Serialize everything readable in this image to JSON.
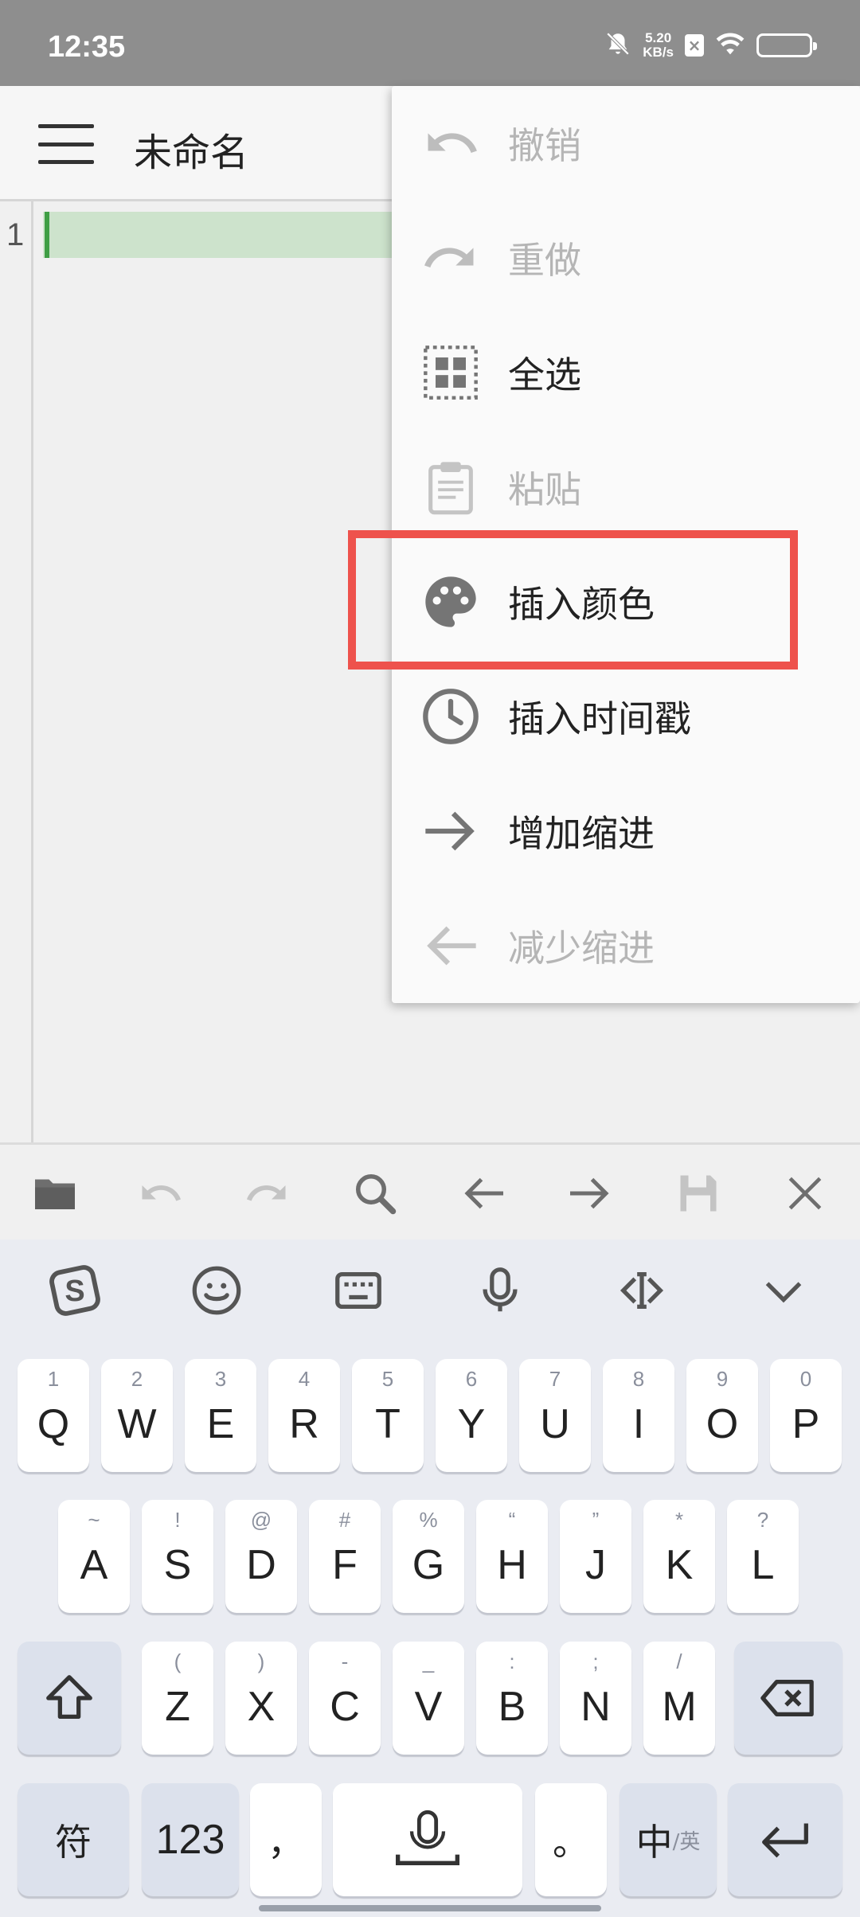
{
  "status_bar": {
    "time": "12:35",
    "net_speed_value": "5.20",
    "net_speed_unit": "KB/s",
    "icons": [
      "mute-bell-icon",
      "close-badge-icon",
      "wifi-icon",
      "battery-icon"
    ]
  },
  "toolbar": {
    "title": "未命名"
  },
  "editor": {
    "line_number": "1"
  },
  "dropdown": {
    "items": [
      {
        "label": "撤销",
        "icon": "undo-icon",
        "enabled": false
      },
      {
        "label": "重做",
        "icon": "redo-icon",
        "enabled": false
      },
      {
        "label": "全选",
        "icon": "select-all-icon",
        "enabled": true
      },
      {
        "label": "粘贴",
        "icon": "paste-icon",
        "enabled": false
      },
      {
        "label": "插入颜色",
        "icon": "palette-icon",
        "enabled": true,
        "highlighted": true
      },
      {
        "label": "插入时间戳",
        "icon": "clock-icon",
        "enabled": true
      },
      {
        "label": "增加缩进",
        "icon": "arrow-right-icon",
        "enabled": true
      },
      {
        "label": "减少缩进",
        "icon": "arrow-left-icon",
        "enabled": false
      }
    ],
    "highlight_color": "#ee524c"
  },
  "action_bar": {
    "icons": [
      "folder-icon",
      "undo-icon",
      "redo-icon",
      "search-icon",
      "arrow-left-icon",
      "arrow-right-icon",
      "save-icon",
      "close-icon"
    ]
  },
  "keyboard": {
    "toolbar_icons": [
      "sogou-logo-icon",
      "emoji-icon",
      "keyboard-icon",
      "microphone-icon",
      "cursor-icon",
      "chevron-down-icon"
    ],
    "row1": [
      {
        "main": "Q",
        "sub": "1"
      },
      {
        "main": "W",
        "sub": "2"
      },
      {
        "main": "E",
        "sub": "3"
      },
      {
        "main": "R",
        "sub": "4"
      },
      {
        "main": "T",
        "sub": "5"
      },
      {
        "main": "Y",
        "sub": "6"
      },
      {
        "main": "U",
        "sub": "7"
      },
      {
        "main": "I",
        "sub": "8"
      },
      {
        "main": "O",
        "sub": "9"
      },
      {
        "main": "P",
        "sub": "0"
      }
    ],
    "row2": [
      {
        "main": "A",
        "sub": "~"
      },
      {
        "main": "S",
        "sub": "!"
      },
      {
        "main": "D",
        "sub": "@"
      },
      {
        "main": "F",
        "sub": "#"
      },
      {
        "main": "G",
        "sub": "%"
      },
      {
        "main": "H",
        "sub": "“"
      },
      {
        "main": "J",
        "sub": "”"
      },
      {
        "main": "K",
        "sub": "*"
      },
      {
        "main": "L",
        "sub": "?"
      }
    ],
    "row3": [
      {
        "main": "Z",
        "sub": "("
      },
      {
        "main": "X",
        "sub": ")"
      },
      {
        "main": "C",
        "sub": "-"
      },
      {
        "main": "V",
        "sub": "_"
      },
      {
        "main": "B",
        "sub": ":"
      },
      {
        "main": "N",
        "sub": ";"
      },
      {
        "main": "M",
        "sub": "/"
      }
    ],
    "symbol_key": "符",
    "number_key": "123",
    "comma_key": "，",
    "period_key": "。",
    "lang_key_main": "中",
    "lang_key_sub": "/英"
  }
}
